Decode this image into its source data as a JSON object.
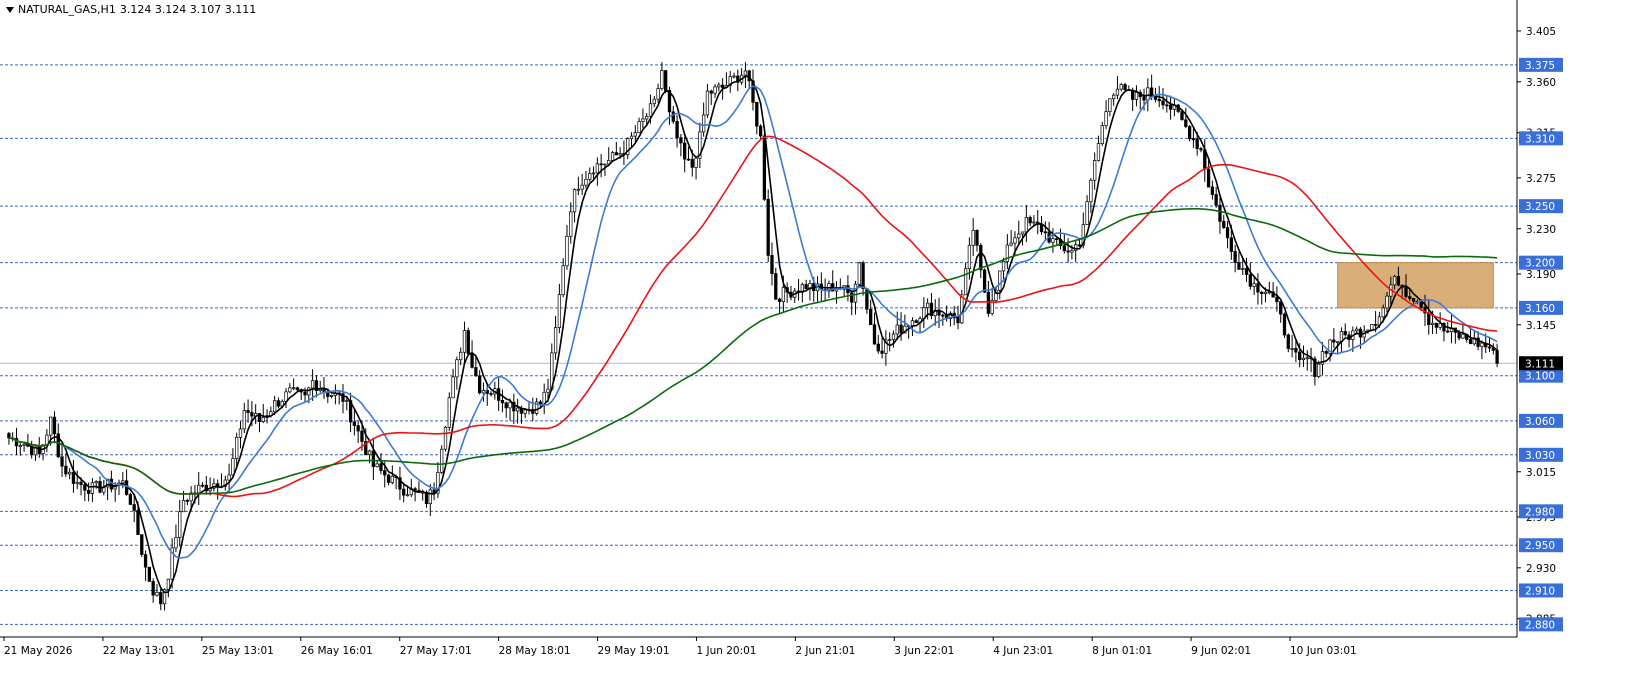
{
  "header": {
    "symbol": "NATURAL_GAS,H1",
    "ohlc": "3.124 3.124 3.107 3.111"
  },
  "colors": {
    "candle": "#000000",
    "ma_black": "#000000",
    "ma_blue": "#3a7bd5",
    "ma_red": "#ee1111",
    "ma_green": "#0b6a0b",
    "level_line": "#3a66c8",
    "level_label_bg": "#3a6fd8",
    "current_label_bg": "#000000",
    "zone": "#d6a56a",
    "zone_border": "#c68a42"
  },
  "chart_data": {
    "type": "candlestick",
    "title": "NATURAL_GAS,H1",
    "ylim": [
      2.875,
      3.42
    ],
    "y_ticks": [
      "3.405",
      "3.360",
      "3.315",
      "3.275",
      "3.230",
      "3.190",
      "3.145",
      "3.015",
      "2.975",
      "2.930",
      "2.885"
    ],
    "x_ticks": [
      "21 May 2026",
      "22 May 13:01",
      "25 May 13:01",
      "26 May 16:01",
      "27 May 17:01",
      "28 May 18:01",
      "29 May 19:01",
      "1 Jun 20:01",
      "2 Jun 21:01",
      "3 Jun 22:01",
      "4 Jun 23:01",
      "8 Jun 01:01",
      "9 Jun 02:01",
      "10 Jun 03:01"
    ],
    "levels": [
      "3.375",
      "3.310",
      "3.250",
      "3.200",
      "3.160",
      "3.100",
      "3.060",
      "3.030",
      "2.980",
      "2.950",
      "2.910",
      "2.880"
    ],
    "current_price": "3.111",
    "zone": {
      "from": 3.16,
      "to": 3.2
    },
    "anchors": [
      [
        0,
        3.045
      ],
      [
        4,
        3.04
      ],
      [
        8,
        3.03
      ],
      [
        11,
        3.06
      ],
      [
        14,
        3.02
      ],
      [
        18,
        3.005
      ],
      [
        22,
        3.0
      ],
      [
        26,
        3.003
      ],
      [
        30,
        3.005
      ],
      [
        32,
        2.99
      ],
      [
        34,
        2.96
      ],
      [
        36,
        2.93
      ],
      [
        38,
        2.91
      ],
      [
        40,
        2.9
      ],
      [
        42,
        2.925
      ],
      [
        44,
        2.96
      ],
      [
        46,
        2.99
      ],
      [
        50,
        3.0
      ],
      [
        54,
        3.005
      ],
      [
        58,
        3.01
      ],
      [
        60,
        3.04
      ],
      [
        62,
        3.07
      ],
      [
        66,
        3.06
      ],
      [
        70,
        3.075
      ],
      [
        74,
        3.085
      ],
      [
        78,
        3.08
      ],
      [
        80,
        3.095
      ],
      [
        84,
        3.085
      ],
      [
        88,
        3.08
      ],
      [
        92,
        3.05
      ],
      [
        96,
        3.02
      ],
      [
        100,
        3.01
      ],
      [
        104,
        3.0
      ],
      [
        108,
        2.995
      ],
      [
        110,
        2.99
      ],
      [
        112,
        3.0
      ],
      [
        114,
        3.04
      ],
      [
        116,
        3.08
      ],
      [
        118,
        3.11
      ],
      [
        120,
        3.14
      ],
      [
        122,
        3.11
      ],
      [
        124,
        3.09
      ],
      [
        128,
        3.085
      ],
      [
        132,
        3.075
      ],
      [
        136,
        3.07
      ],
      [
        140,
        3.075
      ],
      [
        142,
        3.09
      ],
      [
        144,
        3.14
      ],
      [
        146,
        3.2
      ],
      [
        148,
        3.25
      ],
      [
        150,
        3.27
      ],
      [
        154,
        3.285
      ],
      [
        158,
        3.29
      ],
      [
        162,
        3.3
      ],
      [
        166,
        3.32
      ],
      [
        170,
        3.34
      ],
      [
        172,
        3.37
      ],
      [
        174,
        3.33
      ],
      [
        176,
        3.31
      ],
      [
        178,
        3.29
      ],
      [
        180,
        3.285
      ],
      [
        182,
        3.31
      ],
      [
        184,
        3.35
      ],
      [
        188,
        3.355
      ],
      [
        192,
        3.365
      ],
      [
        194,
        3.37
      ],
      [
        196,
        3.34
      ],
      [
        198,
        3.31
      ],
      [
        200,
        3.21
      ],
      [
        202,
        3.17
      ],
      [
        206,
        3.175
      ],
      [
        210,
        3.18
      ],
      [
        214,
        3.175
      ],
      [
        218,
        3.18
      ],
      [
        222,
        3.17
      ],
      [
        224,
        3.2
      ],
      [
        226,
        3.16
      ],
      [
        228,
        3.13
      ],
      [
        230,
        3.125
      ],
      [
        234,
        3.14
      ],
      [
        238,
        3.15
      ],
      [
        242,
        3.16
      ],
      [
        246,
        3.155
      ],
      [
        250,
        3.15
      ],
      [
        252,
        3.19
      ],
      [
        254,
        3.23
      ],
      [
        256,
        3.19
      ],
      [
        258,
        3.16
      ],
      [
        260,
        3.18
      ],
      [
        262,
        3.2
      ],
      [
        264,
        3.22
      ],
      [
        268,
        3.235
      ],
      [
        272,
        3.23
      ],
      [
        276,
        3.215
      ],
      [
        280,
        3.21
      ],
      [
        282,
        3.22
      ],
      [
        284,
        3.25
      ],
      [
        286,
        3.29
      ],
      [
        288,
        3.32
      ],
      [
        290,
        3.35
      ],
      [
        292,
        3.355
      ],
      [
        296,
        3.345
      ],
      [
        300,
        3.35
      ],
      [
        304,
        3.345
      ],
      [
        308,
        3.33
      ],
      [
        312,
        3.31
      ],
      [
        314,
        3.3
      ],
      [
        316,
        3.27
      ],
      [
        318,
        3.25
      ],
      [
        320,
        3.23
      ],
      [
        322,
        3.21
      ],
      [
        324,
        3.2
      ],
      [
        326,
        3.19
      ],
      [
        328,
        3.18
      ],
      [
        332,
        3.175
      ],
      [
        334,
        3.16
      ],
      [
        336,
        3.14
      ],
      [
        338,
        3.12
      ],
      [
        340,
        3.11
      ],
      [
        342,
        3.115
      ],
      [
        344,
        3.105
      ],
      [
        346,
        3.12
      ],
      [
        348,
        3.13
      ],
      [
        352,
        3.135
      ],
      [
        356,
        3.14
      ],
      [
        360,
        3.15
      ],
      [
        362,
        3.16
      ],
      [
        364,
        3.18
      ],
      [
        366,
        3.185
      ],
      [
        368,
        3.175
      ],
      [
        370,
        3.17
      ],
      [
        372,
        3.165
      ],
      [
        374,
        3.15
      ],
      [
        378,
        3.14
      ],
      [
        382,
        3.135
      ],
      [
        386,
        3.13
      ],
      [
        390,
        3.125
      ],
      [
        392,
        3.111
      ]
    ],
    "series": [
      {
        "name": "",
        "kind": "ma-short",
        "period": 5
      },
      {
        "name": "",
        "kind": "ma-fast",
        "period": 14
      },
      {
        "name": "",
        "kind": "ma-mid",
        "period": 55
      },
      {
        "name": "",
        "kind": "ma-slow",
        "period": 150
      }
    ]
  }
}
